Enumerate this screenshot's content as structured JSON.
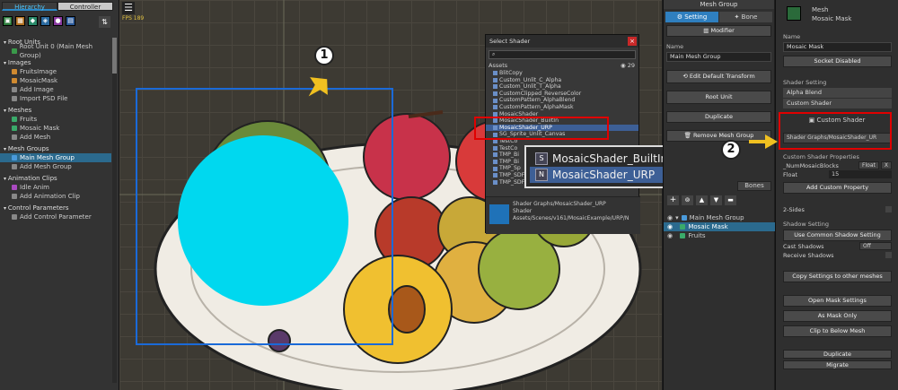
{
  "hierarchy": {
    "tabs": [
      "Hierarchy",
      "Controller"
    ],
    "sections": [
      {
        "title": "Root Units",
        "items": [
          {
            "label": "Root Unit 0 (Main Mesh Group)",
            "selected": false
          }
        ]
      },
      {
        "title": "Images",
        "items": [
          {
            "label": "FruitsImage",
            "selected": false
          },
          {
            "label": "MosaicMask",
            "selected": false
          },
          {
            "label": "Add Image",
            "selected": false
          },
          {
            "label": "Import PSD File",
            "selected": false
          }
        ]
      },
      {
        "title": "Meshes",
        "items": [
          {
            "label": "Fruits",
            "selected": false
          },
          {
            "label": "Mosaic Mask",
            "selected": false
          },
          {
            "label": "Add Mesh",
            "selected": false
          }
        ]
      },
      {
        "title": "Mesh Groups",
        "items": [
          {
            "label": "Main Mesh Group",
            "selected": true
          },
          {
            "label": "Add Mesh Group",
            "selected": false
          }
        ]
      },
      {
        "title": "Animation Clips",
        "items": [
          {
            "label": "Idle Anim",
            "selected": false
          },
          {
            "label": "Add Animation Clip",
            "selected": false
          }
        ]
      },
      {
        "title": "Control Parameters",
        "items": [
          {
            "label": "Add Control Parameter",
            "selected": false
          }
        ]
      }
    ]
  },
  "viewport": {
    "fps": "FPS 189"
  },
  "shader_dialog": {
    "title": "Select Shader",
    "assets_label": "Assets",
    "count": "29",
    "list": [
      "BlitCopy",
      "Custom_Unlit_C_Alpha",
      "Custom_Unlit_T_Alpha",
      "CustomClipped_ReverseColor",
      "CustomPattern_AlphaBlend",
      "CustomPattern_AlphaMask",
      "MosaicShader",
      "MosaicShader_BuiltIn",
      "MosaicShader_URP",
      "SG_Sprite_Unlit_Canvas",
      "TestCo",
      "TestCo",
      "TMP_Bi",
      "TMP_Bi",
      "TMP_Sp",
      "TMP_SDF",
      "TMP_SDF Overlay"
    ],
    "selected_index": 8,
    "info_lines": [
      "Shader Graphs/MosaicShader_URP",
      "Shader",
      "Assets/Scenes/v161/MosaicExample/URP/N"
    ]
  },
  "zoom_callout": {
    "items": [
      "MosaicShader_BuiltIn",
      "MosaicShader_URP"
    ],
    "selected_index": 1
  },
  "mesh_group": {
    "title": "Mesh Group",
    "tabs": [
      "Setting",
      "Bone"
    ],
    "modifier_label": "Modifier",
    "name_label": "Name",
    "name_value": "Main Mesh Group",
    "buttons": [
      "Edit Default Transform",
      "Root Unit",
      "Duplicate",
      "Remove Mesh Group"
    ],
    "subtabs": [
      "Bones"
    ],
    "tree": [
      {
        "label": "Main Mesh Group",
        "selected": false
      },
      {
        "label": "Mosaic Mask",
        "selected": true
      },
      {
        "label": "Fruits",
        "selected": false
      }
    ]
  },
  "inspector": {
    "header_type": "Mesh",
    "header_name": "Mosaic Mask",
    "name_label": "Name",
    "name_value": "Mosaic Mask",
    "socket_button": "Socket Disabled",
    "shader_setting_label": "Shader Setting",
    "blend_value": "Alpha Blend",
    "shader_mode": "Custom Shader",
    "custom_shader_label": "Custom Shader",
    "shader_path": "Shader Graphs/MosaicShader_UR",
    "custom_props_label": "Custom Shader Properties",
    "prop_name": "_NumMosaicBlocks",
    "prop_type": "Float",
    "prop_x": "X",
    "prop_value_label": "Float",
    "prop_value": "15",
    "add_prop_button": "Add Custom Property",
    "two_sides_label": "2-Sides",
    "shadow_label": "Shadow Setting",
    "common_shadow_button": "Use Common Shadow Setting",
    "cast_label": "Cast Shadows",
    "cast_value": "Off",
    "receive_label": "Receive Shadows",
    "copy_button": "Copy Settings to other meshes",
    "mask_button": "Open Mask Settings",
    "mask_only_button": "As Mask Only",
    "clip_button": "Clip to Below Mesh",
    "duplicate_button": "Duplicate",
    "migrate_button": "Migrate"
  },
  "badges": [
    "1",
    "2"
  ],
  "colors": {
    "accent": "#2a89c8",
    "highlight": "#e00000",
    "mask": "#00d8ef",
    "selection": "#3d5f96"
  }
}
